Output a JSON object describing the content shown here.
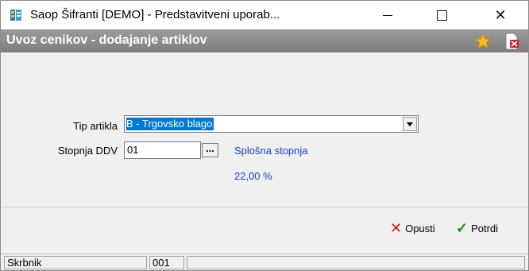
{
  "window": {
    "title": "Saop Šifranti [DEMO] - Predstavitveni uporab..."
  },
  "header": {
    "title": "Uvoz cenikov - dodajanje artiklov"
  },
  "form": {
    "tip_label": "Tip artikla",
    "tip_value": "B - Trgovsko blago",
    "ddv_label": "Stopnja DDV",
    "ddv_value": "01",
    "ddv_button": "...",
    "rate_name": "Splošna stopnja",
    "rate_value": "22,00 %"
  },
  "actions": {
    "cancel_label": "Opusti",
    "confirm_label": "Potrdi"
  },
  "status": {
    "user": "Skrbnik",
    "code": "001",
    "extra": ""
  }
}
